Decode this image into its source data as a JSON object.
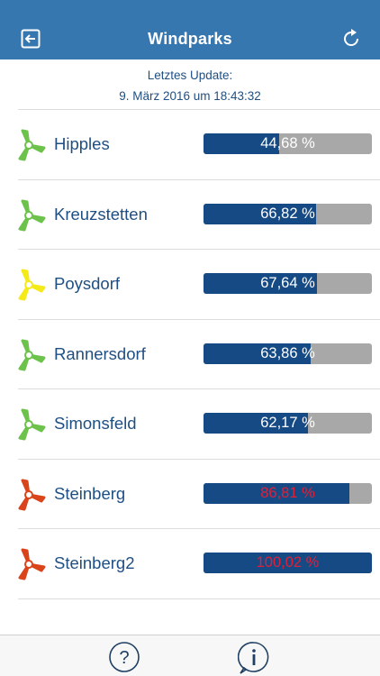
{
  "header": {
    "title": "Windparks",
    "back_icon": "exit-icon",
    "refresh_icon": "refresh-icon",
    "background": "#3777b0"
  },
  "update": {
    "label": "Letztes Update:",
    "timestamp": "9. März 2016 um 18:43:32"
  },
  "colors": {
    "bar_fill": "#164a85",
    "bar_track": "#a8a8a8",
    "over_label": "#e0203a",
    "turbine_green": "#6cc24a",
    "turbine_yellow": "#f4ea1a",
    "turbine_red": "#d9441a"
  },
  "parks": [
    {
      "name": "Hipples",
      "value": 44.68,
      "label": "44,68 %",
      "turbine_color": "green"
    },
    {
      "name": "Kreuzstetten",
      "value": 66.82,
      "label": "66,82 %",
      "turbine_color": "green"
    },
    {
      "name": "Poysdorf",
      "value": 67.64,
      "label": "67,64 %",
      "turbine_color": "yellow"
    },
    {
      "name": "Rannersdorf",
      "value": 63.86,
      "label": "63,86 %",
      "turbine_color": "green"
    },
    {
      "name": "Simonsfeld",
      "value": 62.17,
      "label": "62,17 %",
      "turbine_color": "green"
    },
    {
      "name": "Steinberg",
      "value": 86.81,
      "label": "86,81 %",
      "turbine_color": "red"
    },
    {
      "name": "Steinberg2",
      "value": 100.02,
      "label": "100,02 %",
      "turbine_color": "red"
    }
  ],
  "tabbar": {
    "help_icon": "question-icon",
    "info_icon": "info-icon"
  }
}
